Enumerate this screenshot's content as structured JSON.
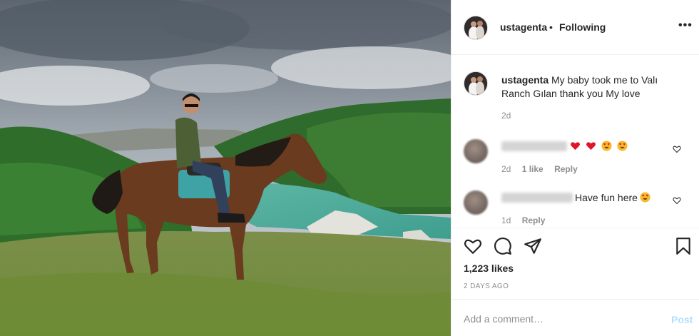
{
  "post": {
    "image_alt": "Man riding a brown horse on a grassy hill above a turquoise lake and green mountains",
    "username": "ustagenta",
    "separator": "•",
    "follow_status": "Following",
    "more_icon": "more-options-icon",
    "caption": {
      "username": "ustagenta",
      "text": "My baby took me to Valı Ranch Gılan thank you My love",
      "time": "2d"
    },
    "comments": [
      {
        "username_blurred": true,
        "text": "",
        "emojis": [
          "red-heart",
          "red-heart",
          "heart-eyes",
          "heart-eyes"
        ],
        "time": "2d",
        "likes": "1 like",
        "reply": "Reply"
      },
      {
        "username_blurred": true,
        "text": "Have fun here",
        "emojis": [
          "heart-eyes"
        ],
        "time": "1d",
        "likes": "",
        "reply": "Reply"
      }
    ],
    "actions": {
      "like_icon": "heart-icon",
      "comment_icon": "comment-icon",
      "share_icon": "share-icon",
      "save_icon": "bookmark-icon"
    },
    "likes": "1,223 likes",
    "posted": "2 DAYS AGO",
    "add_comment": {
      "placeholder": "Add a comment…",
      "post_label": "Post"
    },
    "colors": {
      "text": "#262626",
      "secondary": "#8e8e8e",
      "post_disabled": "#b2dffc",
      "border": "#efefef"
    }
  }
}
